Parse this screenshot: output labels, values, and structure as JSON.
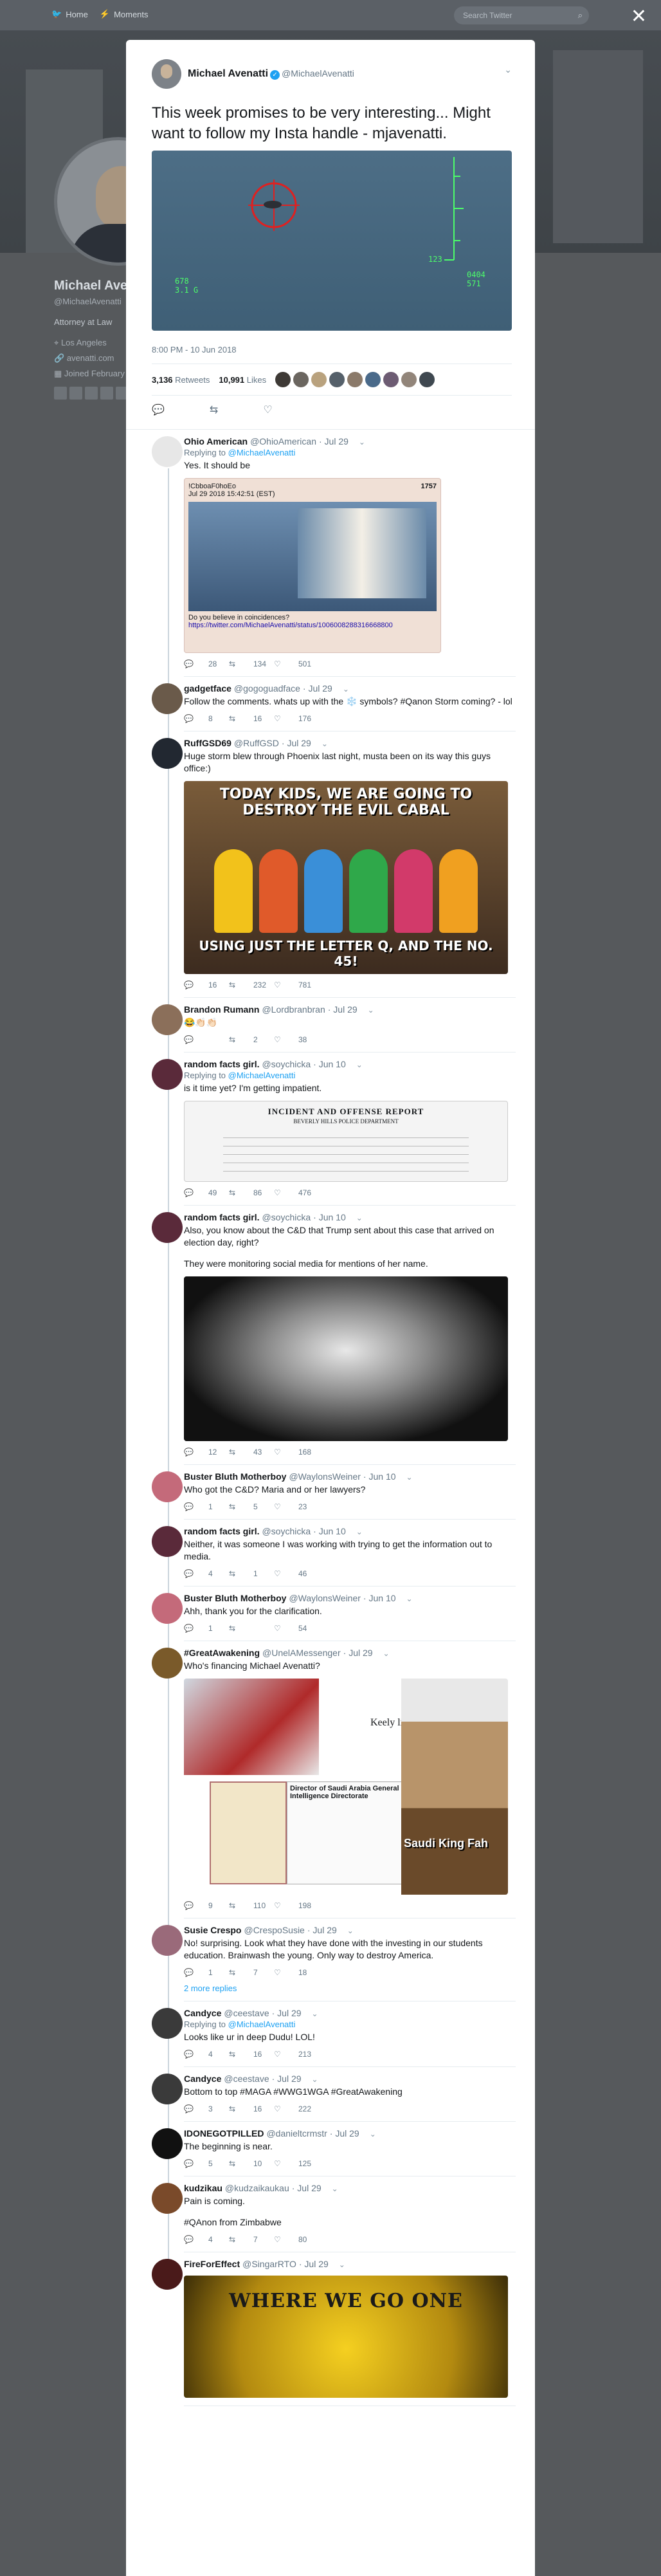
{
  "nav": {
    "home": "Home",
    "moments": "Moments",
    "search_placeholder": "Search Twitter"
  },
  "profile_bg": {
    "name": "Michael Avenatti",
    "handle": "@MichaelAvenatti",
    "bio": "Attorney at Law",
    "location": "Los Angeles",
    "website": "avenatti.com",
    "joined": "Joined February"
  },
  "main_tweet": {
    "name": "Michael Avenatti",
    "handle": "@MichaelAvenatti",
    "text": "This week promises to be very interesting... Might want to follow my Insta handle - mjavenatti.",
    "hud_left1": "678",
    "hud_left2": "3.1 G",
    "hud_right1": "0404",
    "hud_right2": "571",
    "hud_tick": "123",
    "timestamp": "8:00 PM - 10 Jun 2018",
    "retweets_count": "3,136",
    "retweets_label": "Retweets",
    "likes_count": "10,991",
    "likes_label": "Likes"
  },
  "replies": [
    {
      "name": "Ohio American",
      "handle": "@OhioAmerican",
      "time": "Jul 29",
      "replying_label": "Replying to",
      "replying_to": "@MichaelAvenatti",
      "text": [
        "Yes.  It should be"
      ],
      "card": {
        "line1": "!CbboaF0hoEo",
        "line2": "Jul 29 2018 15:42:51 (EST)",
        "id": "1757",
        "caption": "Do you believe in coincidences?",
        "link": "https://twitter.com/MichaelAvenatti/status/1006008288316668800"
      },
      "replies_count": "28",
      "retweets_count": "134",
      "likes_count": "501"
    },
    {
      "name": "gadgetface",
      "handle": "@gogoguadface",
      "time": "Jul 29",
      "text": [
        "Follow the comments.  whats up with the ❄️ symbols? #Qanon Storm coming? - lol"
      ],
      "replies_count": "8",
      "retweets_count": "16",
      "likes_count": "176"
    },
    {
      "name": "RuffGSD69",
      "handle": "@RuffGSD",
      "time": "Jul 29",
      "text": [
        "Huge storm blew through Phoenix last night, musta been on its way this guys office:)"
      ],
      "meme_top": "TODAY KIDS, WE ARE GOING TO DESTROY THE EVIL CABAL",
      "meme_bottom": "USING JUST THE LETTER Q, AND THE NO. 45!",
      "replies_count": "16",
      "retweets_count": "232",
      "likes_count": "781"
    },
    {
      "name": "Brandon Rumann",
      "handle": "@Lordbranbran",
      "time": "Jul 29",
      "text": [
        "😂👏🏻👏🏻"
      ],
      "replies_count": "",
      "retweets_count": "2",
      "likes_count": "38"
    },
    {
      "name": "random facts girl.",
      "handle": "@soychicka",
      "time": "Jun 10",
      "replying_label": "Replying to",
      "replying_to": "@MichaelAvenatti",
      "text": [
        "is it time yet?  I'm getting impatient."
      ],
      "doc_title": "INCIDENT AND OFFENSE REPORT",
      "doc_dept": "BEVERLY HILLS POLICE DEPARTMENT",
      "replies_count": "49",
      "retweets_count": "86",
      "likes_count": "476"
    },
    {
      "name": "random facts girl.",
      "handle": "@soychicka",
      "time": "Jun 10",
      "text": [
        "Also, you know about the C&D that Trump sent about this case that arrived on election day, right?",
        "They were monitoring social media for mentions of her name."
      ],
      "replies_count": "12",
      "retweets_count": "43",
      "likes_count": "168"
    },
    {
      "name": "Buster Bluth Motherboy",
      "handle": "@WaylonsWeiner",
      "time": "Jun 10",
      "text": [
        "Who got the C&D? Maria and or her lawyers?"
      ],
      "replies_count": "1",
      "retweets_count": "5",
      "likes_count": "23"
    },
    {
      "name": "random facts girl.",
      "handle": "@soychicka",
      "time": "Jun 10",
      "text": [
        "Neither, it was someone I was working with trying to get the information out to media."
      ],
      "replies_count": "4",
      "retweets_count": "1",
      "likes_count": "46"
    },
    {
      "name": "Buster Bluth Motherboy",
      "handle": "@WaylonsWeiner",
      "time": "Jun 10",
      "text": [
        "Ahh, thank you for the clarification."
      ],
      "replies_count": "1",
      "retweets_count": "",
      "likes_count": "54"
    },
    {
      "name": "#GreatAwakening",
      "handle": "@UnelAMessenger",
      "time": "Jul 29",
      "text": [
        "Who's financing Michael Avenatti?"
      ],
      "collage_caption": "Saudi King Fah",
      "collage_heading": "Keely life and",
      "collage_director": "Director of Saudi Arabia General Intelligence Directorate",
      "replies_count": "9",
      "retweets_count": "110",
      "likes_count": "198"
    },
    {
      "name": "Susie Crespo",
      "handle": "@CrespoSusie",
      "time": "Jul 29",
      "text": [
        "No! surprising. Look what they have done with the investing in our students education. Brainwash the young. Only way to destroy America."
      ],
      "replies_count": "1",
      "retweets_count": "7",
      "likes_count": "18",
      "more_replies": "2 more replies"
    },
    {
      "name": "Candyce",
      "handle": "@ceestave",
      "time": "Jul 29",
      "replying_label": "Replying to",
      "replying_to": "@MichaelAvenatti",
      "text": [
        "Looks like ur in deep Dudu! LOL!"
      ],
      "replies_count": "4",
      "retweets_count": "16",
      "likes_count": "213"
    },
    {
      "name": "Candyce",
      "handle": "@ceestave",
      "time": "Jul 29",
      "text": [
        "Bottom to top #MAGA #WWG1WGA #GreatAwakening"
      ],
      "replies_count": "3",
      "retweets_count": "16",
      "likes_count": "222"
    },
    {
      "name": "IDONEGOTPILLED",
      "handle": "@danieltcrmstr",
      "time": "Jul 29",
      "text": [
        "The beginning is near."
      ],
      "replies_count": "5",
      "retweets_count": "10",
      "likes_count": "125"
    },
    {
      "name": "kudzikau",
      "handle": "@kudzaikaukau",
      "time": "Jul 29",
      "text": [
        "Pain is coming.",
        "#QAnon from Zimbabwe"
      ],
      "replies_count": "4",
      "retweets_count": "7",
      "likes_count": "80"
    },
    {
      "name": "FireForEffect",
      "handle": "@SingarRTO",
      "time": "Jul 29",
      "text": [],
      "banner_text": "WHERE WE GO ONE"
    }
  ]
}
